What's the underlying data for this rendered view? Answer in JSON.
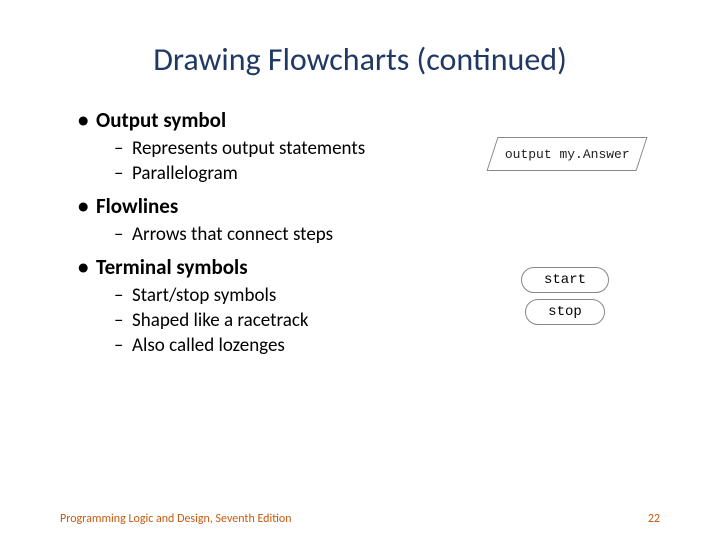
{
  "title": "Drawing Flowcharts (continued)",
  "bullets": {
    "output": "Output symbol",
    "output_sub1": "Represents output statements",
    "output_sub2": "Parallelogram",
    "flowlines": "Flowlines",
    "flowlines_sub1": "Arrows that connect steps",
    "terminal": "Terminal symbols",
    "terminal_sub1": "Start/stop symbols",
    "terminal_sub2": "Shaped like a racetrack",
    "terminal_sub3": "Also called lozenges"
  },
  "shapes": {
    "parallelogram_text": "output my.Answer",
    "start_text": "start",
    "stop_text": "stop"
  },
  "footer": {
    "left": "Programming Logic and Design, Seventh Edition",
    "right": "22"
  }
}
